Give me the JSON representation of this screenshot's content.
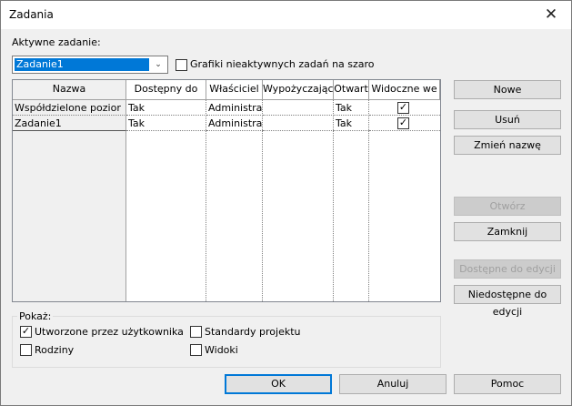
{
  "window": {
    "title": "Zadania",
    "close_glyph": "✕"
  },
  "active_task": {
    "label": "Aktywne zadanie:",
    "value": "Zadanie1"
  },
  "gray_inactive": {
    "label": "Grafiki nieaktywnych zadań na szaro",
    "checked": false
  },
  "table": {
    "columns": [
      "Nazwa",
      "Dostępny do",
      "Właściciel",
      "Wypożyczając",
      "Otwart",
      "Widoczne we"
    ],
    "rows": [
      {
        "name": "Współdzielone pozior",
        "available": "Tak",
        "owner": "Administra",
        "borrowed": "",
        "open": "Tak",
        "visible": true
      },
      {
        "name": "Zadanie1",
        "available": "Tak",
        "owner": "Administra",
        "borrowed": "",
        "open": "Tak",
        "visible": true
      }
    ]
  },
  "buttons": {
    "new": "Nowe",
    "delete": "Usuń",
    "rename": "Zmień nazwę",
    "open": "Otwórz",
    "close": "Zamknij",
    "editable": "Dostępne do edycji",
    "not_editable": "Niedostępne do edycji",
    "ok": "OK",
    "cancel": "Anuluj",
    "help": "Pomoc"
  },
  "show": {
    "label": "Pokaż:",
    "user_created": {
      "label": "Utworzone przez użytkownika",
      "checked": true
    },
    "families": {
      "label": "Rodziny",
      "checked": false
    },
    "project_standards": {
      "label": "Standardy projektu",
      "checked": false
    },
    "views": {
      "label": "Widoki",
      "checked": false
    }
  },
  "check_glyph": "✓",
  "dropdown_glyph": "⌄"
}
